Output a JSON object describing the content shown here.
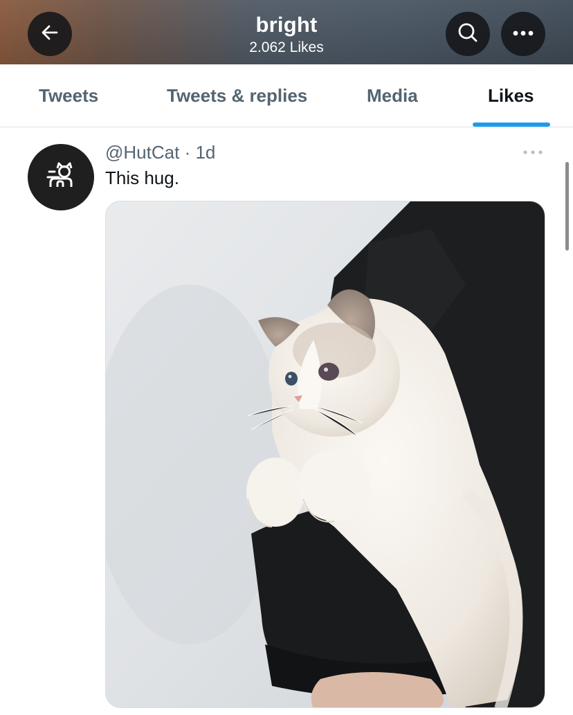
{
  "header": {
    "title": "bright",
    "subtitle": "2.062 Likes",
    "back_icon": "arrow-left-icon",
    "search_icon": "search-icon",
    "more_icon": "more-horizontal-icon"
  },
  "tabs": [
    {
      "label": "Tweets",
      "active": false
    },
    {
      "label": "Tweets & replies",
      "active": false
    },
    {
      "label": "Media",
      "active": false
    },
    {
      "label": "Likes",
      "active": true
    }
  ],
  "tweet": {
    "handle": "@HutCat",
    "separator": "·",
    "age": "1d",
    "text": "This hug.",
    "avatar_icon": "cat-logo-icon",
    "menu_icon": "more-horizontal-icon",
    "media": "photo of a white ragdoll cat held in an arm wearing a black sleeve"
  },
  "colors": {
    "accent": "#1d9bf0",
    "text_primary": "#0f1419",
    "text_secondary": "#536471"
  }
}
